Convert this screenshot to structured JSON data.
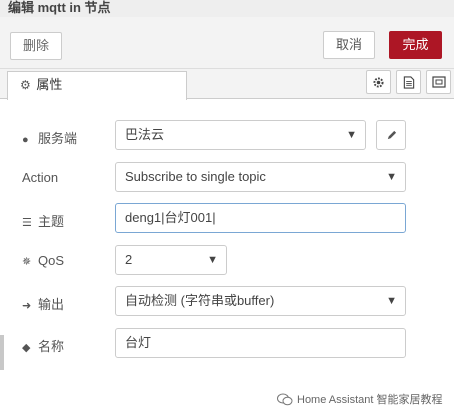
{
  "dialog": {
    "title": "编辑 mqtt in 节点"
  },
  "toolbar": {
    "delete_label": "删除",
    "cancel_label": "取消",
    "done_label": "完成",
    "done_color": "#ad1625"
  },
  "tabs": {
    "properties_label": "属性"
  },
  "form": {
    "server": {
      "label": "服务端",
      "value": "巴法云"
    },
    "action": {
      "label": "Action",
      "value": "Subscribe to single topic"
    },
    "topic": {
      "label": "主题",
      "value": "deng1|台灯001|"
    },
    "qos": {
      "label": "QoS",
      "value": "2"
    },
    "output": {
      "label": "输出",
      "value": "自动检测 (字符串或buffer)"
    },
    "name": {
      "label": "名称",
      "value": "台灯"
    }
  },
  "watermark": {
    "text": "Home Assistant 智能家居教程"
  }
}
